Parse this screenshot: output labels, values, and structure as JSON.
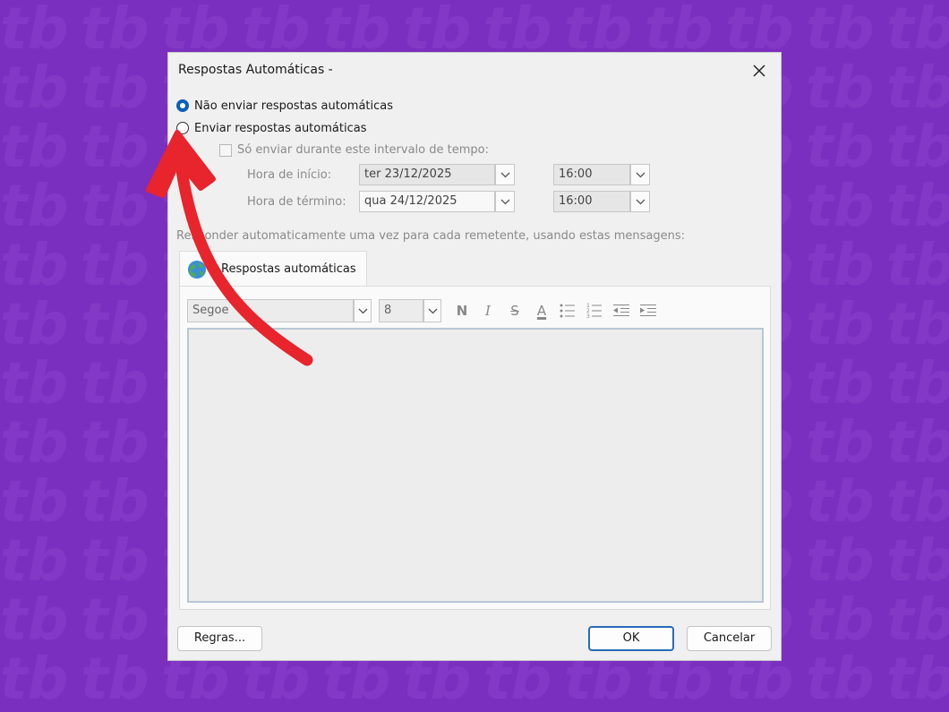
{
  "dialog": {
    "title": "Respostas Automáticas -",
    "radio_dont_send": "Não enviar respostas automáticas",
    "radio_send": "Enviar respostas automáticas",
    "only_during_range": "Só enviar durante este intervalo de tempo:",
    "start_label": "Hora de início:",
    "start_date": "ter 23/12/2025",
    "start_time": "16:00",
    "end_label": "Hora de término:",
    "end_date": "qua 24/12/2025",
    "end_time": "16:00",
    "reply_note": "Responder automaticamente uma vez para cada remetente, usando estas mensagens:",
    "tab_label": "Respostas automáticas",
    "font_name": "Segoe",
    "font_size": "8",
    "bold": "N",
    "italic": "I",
    "strike": "S",
    "font_color": "A",
    "rules_button": "Regras...",
    "ok_button": "OK",
    "cancel_button": "Cancelar"
  },
  "state": {
    "selected_radio": "dont_send",
    "only_during_range_checked": false
  },
  "colors": {
    "background": "#7b2fbe",
    "radio_selected": "#0a5fb8",
    "annotation_arrow": "#e8242d"
  },
  "icons": {
    "close": "close-icon",
    "dropdown": "chevron-down-icon",
    "tab": "globe-icon",
    "bullets": "bullet-list-icon",
    "numbering": "numbered-list-icon",
    "decrease_indent": "decrease-indent-icon",
    "increase_indent": "increase-indent-icon"
  }
}
